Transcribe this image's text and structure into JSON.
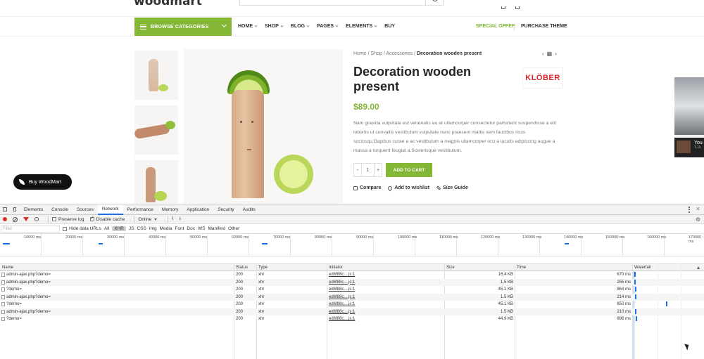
{
  "site": {
    "logo": "woodmart",
    "browse_categories": "BROWSE CATEGORIES",
    "menu": [
      "HOME",
      "SHOP",
      "BLOG",
      "PAGES",
      "ELEMENTS",
      "BUY"
    ],
    "special_offer": "SPECIAL OFFER",
    "purchase_theme": "PURCHASE THEME",
    "accent": "#83b735"
  },
  "product": {
    "breadcrumb": [
      "Home",
      "Shop",
      "Accessories",
      "Decoration wooden present"
    ],
    "breadcrumb_sep": "/",
    "title": "Decoration wooden present",
    "brand": "KLÖBER",
    "price": "$89.00",
    "description": "Nam gravida vulputate est venenatis eu at ullamcorper consectetur parturient suspendisse a elit lobortis ut convallis vestibulum vulputate nunc praesent mattis sem faucibus risus sociosqu.Dapibus curae a ac vestibulum a magnis ullamcorper orci a iaculis adipiscing augue a massa a torquent feugiat a.Scelerisque vestibulum.",
    "qty_minus": "-",
    "qty_value": "1",
    "qty_plus": "+",
    "add_to_cart": "ADD TO CART",
    "compare": "Compare",
    "wishlist": "Add to wishlist",
    "size_guide": "Size Guide"
  },
  "buy_badge": "Buy WoodMart",
  "side_card": {
    "title": "You",
    "sub": "1.1k"
  },
  "devtools": {
    "tabs": [
      "Elements",
      "Console",
      "Sources",
      "Network",
      "Performance",
      "Memory",
      "Application",
      "Security",
      "Audits"
    ],
    "active_tab": "Network",
    "toolbar": {
      "preserve_log": "Preserve log",
      "disable_cache": "Disable cache",
      "throttle": "Online"
    },
    "filter": {
      "placeholder": "Filter",
      "hide_data_urls": "Hide data URLs",
      "types": [
        "All",
        "XHR",
        "JS",
        "CSS",
        "Img",
        "Media",
        "Font",
        "Doc",
        "WS",
        "Manifest",
        "Other"
      ],
      "active_type": "XHR"
    },
    "timeline_labels": [
      "10000 ms",
      "20000 ms",
      "30000 ms",
      "40000 ms",
      "50000 ms",
      "60000 ms",
      "70000 ms",
      "80000 ms",
      "90000 ms",
      "100000 ms",
      "110000 ms",
      "120000 ms",
      "130000 ms",
      "140000 ms",
      "150000 ms",
      "160000 ms",
      "170000 ms"
    ],
    "columns": [
      "Name",
      "Status",
      "Type",
      "Initiator",
      "Size",
      "Time",
      "Waterfall"
    ],
    "rows": [
      {
        "name": "admin-ajax.php?demo=",
        "status": "200",
        "type": "xhr",
        "initiator": "ed6f88c....js:1",
        "size": "16.4 KB",
        "time": "670 ms"
      },
      {
        "name": "admin-ajax.php?demo=",
        "status": "200",
        "type": "xhr",
        "initiator": "ed6f88c....js:1",
        "size": "1.5 KB",
        "time": "255 ms"
      },
      {
        "name": "?demo=",
        "status": "200",
        "type": "xhr",
        "initiator": "ed6f88c....js:1",
        "size": "45.1 KB",
        "time": "864 ms"
      },
      {
        "name": "admin-ajax.php?demo=",
        "status": "200",
        "type": "xhr",
        "initiator": "ed6f88c....js:1",
        "size": "1.5 KB",
        "time": "214 ms"
      },
      {
        "name": "?demo=",
        "status": "200",
        "type": "xhr",
        "initiator": "ed6f88c....js:1",
        "size": "45.1 KB",
        "time": "850 ms"
      },
      {
        "name": "admin-ajax.php?demo=",
        "status": "200",
        "type": "xhr",
        "initiator": "ed6f88c....js:1",
        "size": "1.5 KB",
        "time": "210 ms"
      },
      {
        "name": "?demo=",
        "status": "200",
        "type": "xhr",
        "initiator": "ed6f88c....js:1",
        "size": "44.9 KB",
        "time": "896 ms"
      }
    ]
  }
}
